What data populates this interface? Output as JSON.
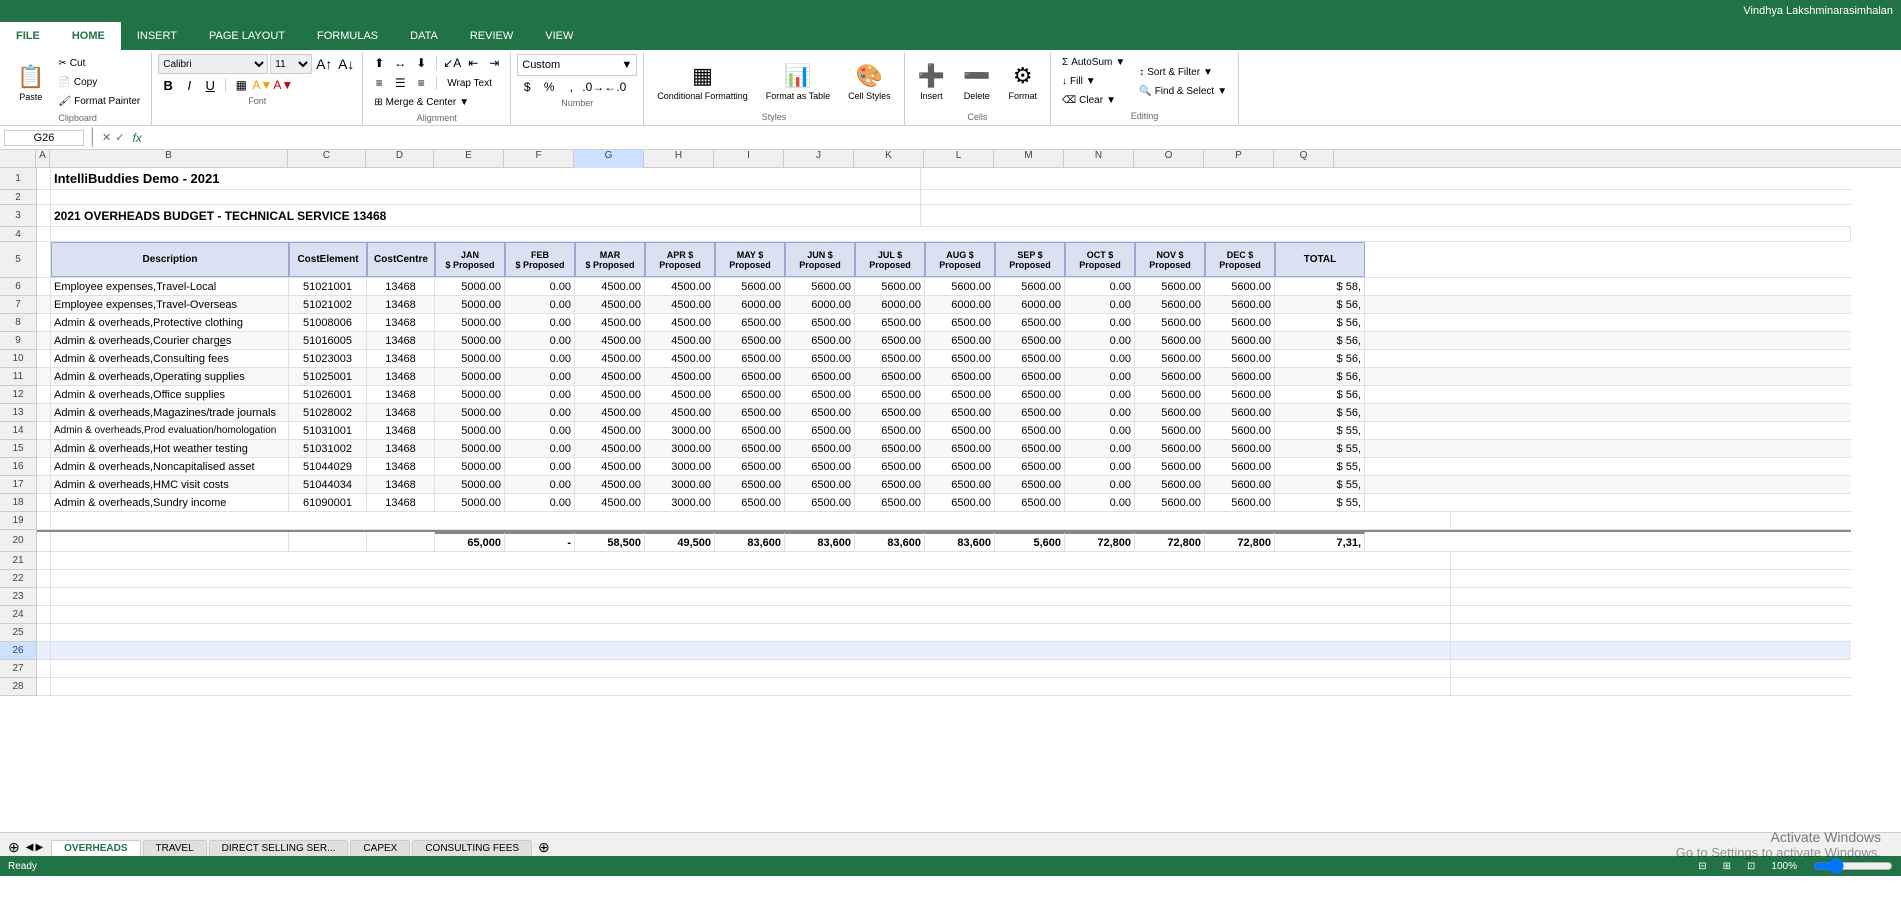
{
  "titleBar": {
    "user": "Vindhya Lakshminarasimhalan"
  },
  "tabs": [
    {
      "label": "FILE",
      "active": false
    },
    {
      "label": "HOME",
      "active": true
    },
    {
      "label": "INSERT",
      "active": false
    },
    {
      "label": "PAGE LAYOUT",
      "active": false
    },
    {
      "label": "FORMULAS",
      "active": false
    },
    {
      "label": "DATA",
      "active": false
    },
    {
      "label": "REVIEW",
      "active": false
    },
    {
      "label": "VIEW",
      "active": false
    }
  ],
  "ribbon": {
    "clipboard": {
      "label": "Clipboard",
      "paste": "Paste",
      "cut": "Cut",
      "copy": "Copy",
      "formatPainter": "Format Painter"
    },
    "font": {
      "label": "Font",
      "fontName": "Calibri",
      "fontSize": "11"
    },
    "alignment": {
      "label": "Alignment",
      "wrapText": "Wrap Text",
      "mergeCenter": "Merge & Center"
    },
    "number": {
      "label": "Number",
      "format": "Custom"
    },
    "styles": {
      "label": "Styles",
      "conditional": "Conditional Formatting",
      "formatAsTable": "Format as Table",
      "cellStyles": "Cell Styles"
    },
    "cells": {
      "label": "Cells",
      "insert": "Insert",
      "delete": "Delete",
      "format": "Format"
    },
    "editing": {
      "label": "Editing",
      "autosum": "AutoSum",
      "fill": "Fill",
      "clear": "Clear",
      "sort": "Sort & Filter",
      "find": "Find & Select"
    }
  },
  "formulaBar": {
    "nameBox": "G26",
    "fx": "fx"
  },
  "spreadsheet": {
    "title1": "IntelliBuddies Demo - 2021",
    "title2": "2021 OVERHEADS BUDGET - TECHNICAL SERVICE 13468",
    "columns": {
      "widths": [
        36,
        240,
        80,
        70,
        70,
        70,
        70,
        70,
        70,
        70,
        70,
        70,
        70,
        70,
        70,
        70,
        70,
        90
      ]
    },
    "headers": {
      "row": [
        "Description",
        "CostElement",
        "CostCentre",
        "JAN\n$ Proposed",
        "FEB\n$ Proposed",
        "MAR\n$ Proposed",
        "APR\n$\nProposed",
        "MAY\n$\nProposed",
        "JUN\n$\nProposed",
        "JUL\n$\nProposed",
        "AUG\n$\nProposed",
        "SEP\n$\nProposed",
        "OCT\n$\nProposed",
        "NOV\n$\nProposed",
        "DEC\n$\nProposed",
        "TOTAL"
      ]
    },
    "rows": [
      {
        "desc": "Employee expenses,Travel-Local",
        "costEl": "51021001",
        "costCen": "13468",
        "jan": "5000.00",
        "feb": "0.00",
        "mar": "4500.00",
        "apr": "4500.00",
        "may": "5600.00",
        "jun": "5600.00",
        "jul": "5600.00",
        "aug": "5600.00",
        "sep": "5600.00",
        "oct": "0.00",
        "nov": "5600.00",
        "dec": "5600.00",
        "total": "$ 58,"
      },
      {
        "desc": "Employee expenses,Travel-Overseas",
        "costEl": "51021002",
        "costCen": "13468",
        "jan": "5000.00",
        "feb": "0.00",
        "mar": "4500.00",
        "apr": "4500.00",
        "may": "6000.00",
        "jun": "6000.00",
        "jul": "6000.00",
        "aug": "6000.00",
        "sep": "6000.00",
        "oct": "0.00",
        "nov": "5600.00",
        "dec": "5600.00",
        "total": "$ 56,"
      },
      {
        "desc": "Admin & overheads,Protective clothing",
        "costEl": "51008006",
        "costCen": "13468",
        "jan": "5000.00",
        "feb": "0.00",
        "mar": "4500.00",
        "apr": "4500.00",
        "may": "6500.00",
        "jun": "6500.00",
        "jul": "6500.00",
        "aug": "6500.00",
        "sep": "6500.00",
        "oct": "0.00",
        "nov": "5600.00",
        "dec": "5600.00",
        "total": "$ 56,"
      },
      {
        "desc": "Admin & overheads,Courier charges",
        "costEl": "51016005",
        "costCen": "13468",
        "jan": "5000.00",
        "feb": "0.00",
        "mar": "4500.00",
        "apr": "4500.00",
        "may": "6500.00",
        "jun": "6500.00",
        "jul": "6500.00",
        "aug": "6500.00",
        "sep": "6500.00",
        "oct": "0.00",
        "nov": "5600.00",
        "dec": "5600.00",
        "total": "$ 56,"
      },
      {
        "desc": "Admin & overheads,Consulting fees",
        "costEl": "51023003",
        "costCen": "13468",
        "jan": "5000.00",
        "feb": "0.00",
        "mar": "4500.00",
        "apr": "4500.00",
        "may": "6500.00",
        "jun": "6500.00",
        "jul": "6500.00",
        "aug": "6500.00",
        "sep": "6500.00",
        "oct": "0.00",
        "nov": "5600.00",
        "dec": "5600.00",
        "total": "$ 56,"
      },
      {
        "desc": "Admin & overheads,Operating supplies",
        "costEl": "51025001",
        "costCen": "13468",
        "jan": "5000.00",
        "feb": "0.00",
        "mar": "4500.00",
        "apr": "4500.00",
        "may": "6500.00",
        "jun": "6500.00",
        "jul": "6500.00",
        "aug": "6500.00",
        "sep": "6500.00",
        "oct": "0.00",
        "nov": "5600.00",
        "dec": "5600.00",
        "total": "$ 56,"
      },
      {
        "desc": "Admin & overheads,Office supplies",
        "costEl": "51026001",
        "costCen": "13468",
        "jan": "5000.00",
        "feb": "0.00",
        "mar": "4500.00",
        "apr": "4500.00",
        "may": "6500.00",
        "jun": "6500.00",
        "jul": "6500.00",
        "aug": "6500.00",
        "sep": "6500.00",
        "oct": "0.00",
        "nov": "5600.00",
        "dec": "5600.00",
        "total": "$ 56,"
      },
      {
        "desc": "Admin & overheads,Magazines/trade journals",
        "costEl": "51028002",
        "costCen": "13468",
        "jan": "5000.00",
        "feb": "0.00",
        "mar": "4500.00",
        "apr": "4500.00",
        "may": "6500.00",
        "jun": "6500.00",
        "jul": "6500.00",
        "aug": "6500.00",
        "sep": "6500.00",
        "oct": "0.00",
        "nov": "5600.00",
        "dec": "5600.00",
        "total": "$ 56,"
      },
      {
        "desc": "Admin & overheads,Prod evaluation/homologation",
        "costEl": "51031001",
        "costCen": "13468",
        "jan": "5000.00",
        "feb": "0.00",
        "mar": "4500.00",
        "apr": "3000.00",
        "may": "6500.00",
        "jun": "6500.00",
        "jul": "6500.00",
        "aug": "6500.00",
        "sep": "6500.00",
        "oct": "0.00",
        "nov": "5600.00",
        "dec": "5600.00",
        "total": "$ 55,"
      },
      {
        "desc": "Admin & overheads,Hot weather testing",
        "costEl": "51031002",
        "costCen": "13468",
        "jan": "5000.00",
        "feb": "0.00",
        "mar": "4500.00",
        "apr": "3000.00",
        "may": "6500.00",
        "jun": "6500.00",
        "jul": "6500.00",
        "aug": "6500.00",
        "sep": "6500.00",
        "oct": "0.00",
        "nov": "5600.00",
        "dec": "5600.00",
        "total": "$ 55,"
      },
      {
        "desc": "Admin & overheads,Noncapitalised asset",
        "costEl": "51044029",
        "costCen": "13468",
        "jan": "5000.00",
        "feb": "0.00",
        "mar": "4500.00",
        "apr": "3000.00",
        "may": "6500.00",
        "jun": "6500.00",
        "jul": "6500.00",
        "aug": "6500.00",
        "sep": "6500.00",
        "oct": "0.00",
        "nov": "5600.00",
        "dec": "5600.00",
        "total": "$ 55,"
      },
      {
        "desc": "Admin & overheads,HMC visit costs",
        "costEl": "51044034",
        "costCen": "13468",
        "jan": "5000.00",
        "feb": "0.00",
        "mar": "4500.00",
        "apr": "3000.00",
        "may": "6500.00",
        "jun": "6500.00",
        "jul": "6500.00",
        "aug": "6500.00",
        "sep": "6500.00",
        "oct": "0.00",
        "nov": "5600.00",
        "dec": "5600.00",
        "total": "$ 55,"
      },
      {
        "desc": "Admin & overheads,Sundry income",
        "costEl": "61090001",
        "costCen": "13468",
        "jan": "5000.00",
        "feb": "0.00",
        "mar": "4500.00",
        "apr": "3000.00",
        "may": "6500.00",
        "jun": "6500.00",
        "jul": "6500.00",
        "aug": "6500.00",
        "sep": "6500.00",
        "oct": "0.00",
        "nov": "5600.00",
        "dec": "5600.00",
        "total": "$ 55,"
      }
    ],
    "totals": {
      "jan": "65,000",
      "feb": "-",
      "mar": "58,500",
      "apr": "49,500",
      "may": "83,600",
      "jun": "83,600",
      "jul": "83,600",
      "aug": "83,600",
      "sep": "5,600",
      "oct": "72,800",
      "nov": "72,800",
      "dec": "72,800",
      "total": "7,31,"
    }
  },
  "sheetTabs": [
    {
      "label": "OVERHEADS",
      "active": true
    },
    {
      "label": "TRAVEL",
      "active": false
    },
    {
      "label": "DIRECT SELLING SER...",
      "active": false
    },
    {
      "label": "CAPEX",
      "active": false
    },
    {
      "label": "CONSULTING FEES",
      "active": false
    }
  ],
  "statusBar": {
    "text": "Ready"
  },
  "activateWindows": {
    "title": "Activate Windows",
    "subtitle": "Go to Settings to activate Windows."
  }
}
